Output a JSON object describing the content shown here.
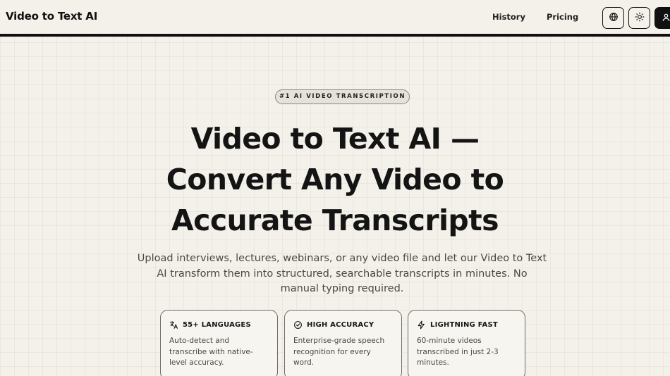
{
  "header": {
    "brand": "Video to Text AI",
    "nav": {
      "history": "History",
      "pricing": "Pricing"
    },
    "icons": {
      "language": "globe-icon",
      "theme": "sun-icon",
      "account": "user-icon"
    }
  },
  "hero": {
    "badge": "#1 AI VIDEO TRANSCRIPTION",
    "title_lines": [
      "Video to Text AI —",
      "Convert Any Video to",
      "Accurate Transcripts"
    ],
    "subtitle_lines": [
      "Upload interviews, lectures, webinars, or any video file and let our Video to Text",
      "AI transform them into structured, searchable transcripts in minutes. No",
      "manual typing required."
    ]
  },
  "features": [
    {
      "icon": "translate-icon",
      "title": "55+ LANGUAGES",
      "desc_lines": [
        "Auto-detect and",
        "transcribe with native-",
        "level accuracy."
      ]
    },
    {
      "icon": "check-circle-icon",
      "title": "HIGH ACCURACY",
      "desc_lines": [
        "Enterprise-grade speech",
        "recognition for every",
        "word."
      ]
    },
    {
      "icon": "lightning-icon",
      "title": "LIGHTNING FAST",
      "desc_lines": [
        "60-minute videos",
        "transcribed in just 2-3",
        "minutes."
      ]
    }
  ],
  "colors": {
    "background": "#f4f1ea",
    "ink": "#111111",
    "muted_text": "#4a4744",
    "badge_bg": "#e6e2d9"
  }
}
